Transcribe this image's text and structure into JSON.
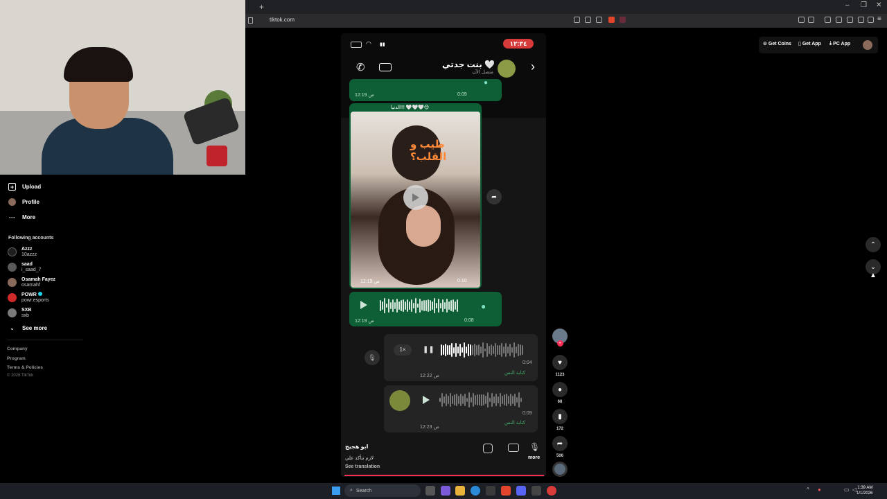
{
  "browser": {
    "url": "tiktok.com",
    "new_tab": "+"
  },
  "sidebar": {
    "nav": [
      {
        "label": "Upload",
        "icon": "plus-square-icon"
      },
      {
        "label": "Profile",
        "icon": "avatar-icon"
      },
      {
        "label": "More",
        "icon": "more-icon"
      }
    ],
    "following_title": "Following accounts",
    "accounts": [
      {
        "name": "Azzz",
        "handle": "10azzz",
        "color": "#1e1e1e"
      },
      {
        "name": "saad",
        "handle": "i_saad_7",
        "color": "#5a5a5a"
      },
      {
        "name": "Osamah Fayez",
        "handle": "osamahf",
        "color": "#8a6a5a"
      },
      {
        "name": "POWR",
        "handle": "powr.esports",
        "color": "#d12a2a"
      },
      {
        "name": "SXB",
        "handle": "sxb",
        "color": "#7a7a7a"
      }
    ],
    "see_more": "See more",
    "footer": [
      "Company",
      "Program",
      "Terms & Policies",
      "© 2026 TikTok"
    ]
  },
  "top_actions": {
    "coins": "Get Coins",
    "app": "Get App",
    "pc": "PC App"
  },
  "phone": {
    "status_time": "١٢:٣٤",
    "contact_name": "بنت جدتي 🤍",
    "contact_status": "متصل الآن",
    "voice1": {
      "time": "12:19 ص",
      "duration": "0:09"
    },
    "video": {
      "caption_top": "الدنيا!!! 🤍🤍🤍😊",
      "overlay": "طيب و القلب؟",
      "time": "12:19 ص",
      "duration": "0:10"
    },
    "voice2": {
      "time": "12:19 ص",
      "duration": "0:08"
    },
    "voice3": {
      "speed": "1×",
      "duration": "0:04",
      "transcribe": "كتابة النص",
      "time": "12:22 ص"
    },
    "voice4": {
      "duration": "0:09",
      "transcribe": "كتابة النص",
      "time": "12:23 ص"
    },
    "more_label": "more"
  },
  "actions": {
    "likes": "1123",
    "comments": "68",
    "saves": "172",
    "shares": "506"
  },
  "caption": {
    "user": "ابو هجيج",
    "text": "لازم تتأكد علي",
    "translate": "See translation"
  },
  "taskbar": {
    "search": "Search",
    "time": "1:39 AM",
    "date": "1/1/2026"
  },
  "colors": {
    "accent": "#fe2c55",
    "bubble_out": "#0e5f36",
    "badge": "#d63a3a"
  }
}
